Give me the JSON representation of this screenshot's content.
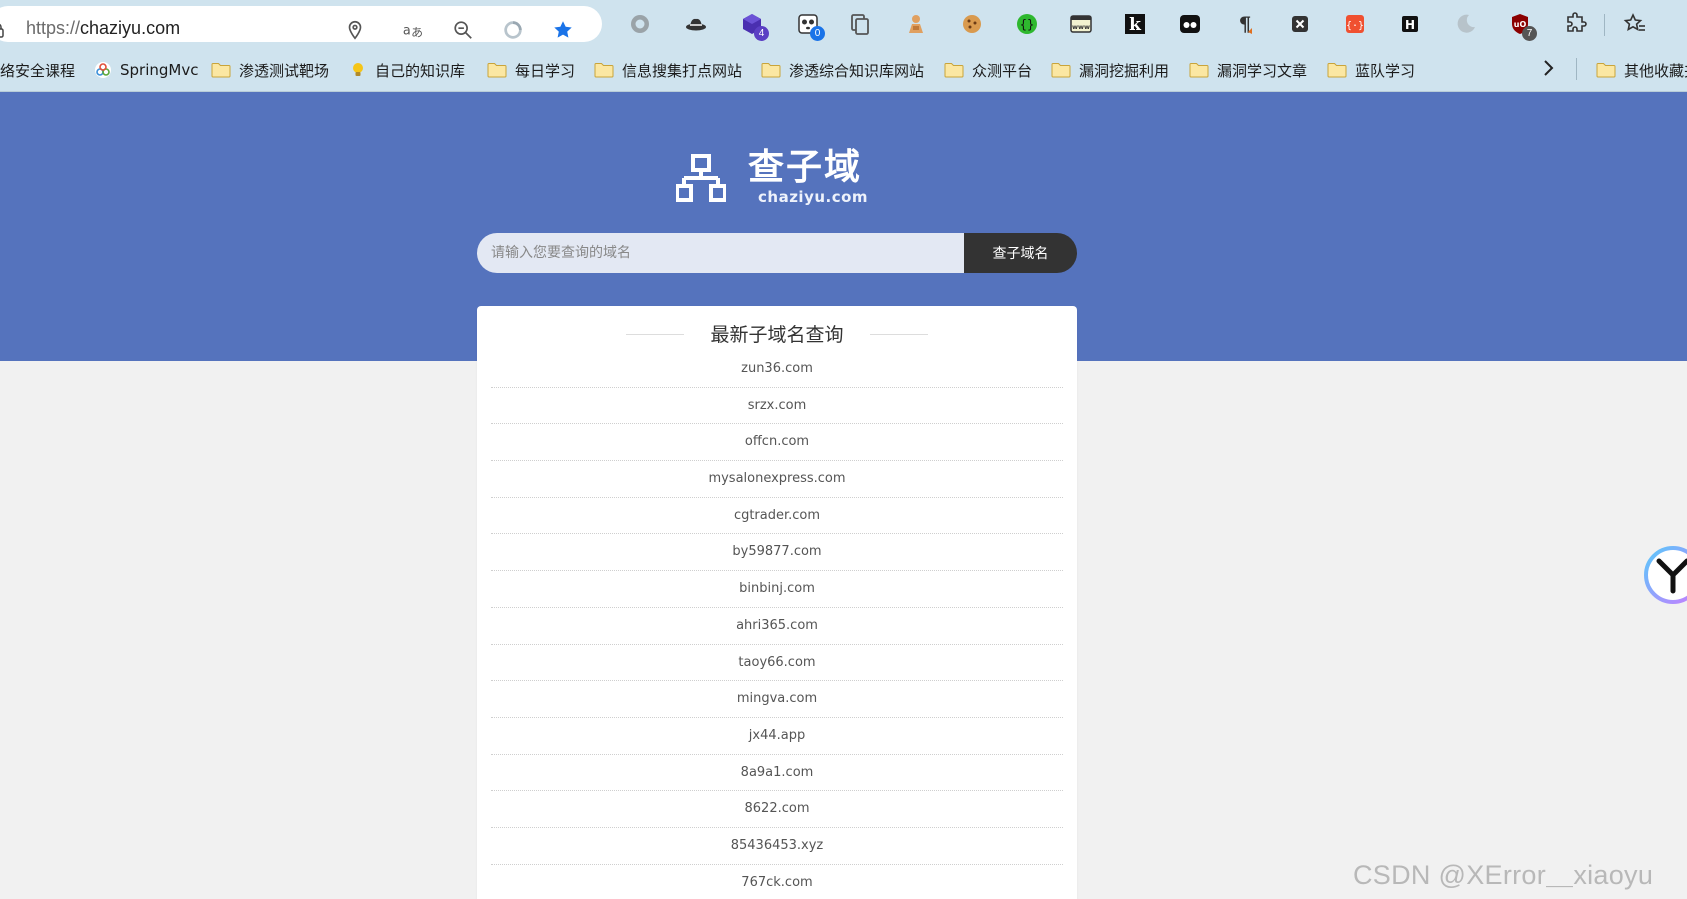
{
  "browser": {
    "url_scheme": "https://",
    "url_host": "chaziyu.com",
    "icons": [
      "lock-icon",
      "location-icon",
      "translate-icon",
      "zoom-out-icon",
      "sync-icon",
      "bookmark-star-icon"
    ],
    "extensions": [
      {
        "name": "circle-extension-icon"
      },
      {
        "name": "hat-extension-icon"
      },
      {
        "name": "cube-extension-icon",
        "badge": "4",
        "badge_color": "#5b3fc4"
      },
      {
        "name": "panda-extension-icon",
        "badge": "0",
        "badge_color": "#1a73e8"
      },
      {
        "name": "copy-extension-icon"
      },
      {
        "name": "person-extension-icon"
      },
      {
        "name": "cookie-extension-icon"
      },
      {
        "name": "bracket-extension-icon"
      },
      {
        "name": "www-extension-icon"
      },
      {
        "name": "k-extension-icon",
        "letter": "k"
      },
      {
        "name": "mask-extension-icon"
      },
      {
        "name": "pilcrow-extension-icon"
      },
      {
        "name": "x-extension-icon"
      },
      {
        "name": "json-extension-icon"
      },
      {
        "name": "h-extension-icon",
        "letter": "H"
      },
      {
        "name": "moon-extension-icon"
      },
      {
        "name": "ublock-extension-icon",
        "badge": "7",
        "badge_color": "#555555"
      },
      {
        "name": "puzzle-icon"
      },
      {
        "name": "favorites-icon"
      }
    ]
  },
  "bookmarks": [
    {
      "label": "络安全课程",
      "icon": "none"
    },
    {
      "label": "SpringMvc",
      "icon": "spring-icon"
    },
    {
      "label": "渗透测试靶场",
      "icon": "folder-icon"
    },
    {
      "label": "自己的知识库",
      "icon": "bulb-icon"
    },
    {
      "label": "每日学习",
      "icon": "folder-icon"
    },
    {
      "label": "信息搜集打点网站",
      "icon": "folder-icon"
    },
    {
      "label": "渗透综合知识库网站",
      "icon": "folder-icon"
    },
    {
      "label": "众测平台",
      "icon": "folder-icon"
    },
    {
      "label": "漏洞挖掘利用",
      "icon": "folder-icon"
    },
    {
      "label": "漏洞学习文章",
      "icon": "folder-icon"
    },
    {
      "label": "蓝队学习",
      "icon": "folder-icon"
    },
    {
      "label": "其他收藏夹",
      "icon": "folder-icon"
    }
  ],
  "site": {
    "logo_title": "查子域",
    "logo_sub": "chaziyu.com",
    "search_placeholder": "请输入您要查询的域名",
    "search_button": "查子域名",
    "list_title": "最新子域名查询",
    "domains": [
      "zun36.com",
      "srzx.com",
      "offcn.com",
      "mysalonexpress.com",
      "cgtrader.com",
      "by59877.com",
      "binbinj.com",
      "ahri365.com",
      "taoy66.com",
      "mingva.com",
      "jx44.app",
      "8a9a1.com",
      "8622.com",
      "85436453.xyz",
      "767ck.com"
    ]
  },
  "watermark": "CSDN @XError＿xiaoyu",
  "colors": {
    "hero": "#5573bd",
    "chrome": "#cfe3ee",
    "search_button": "#333333"
  }
}
